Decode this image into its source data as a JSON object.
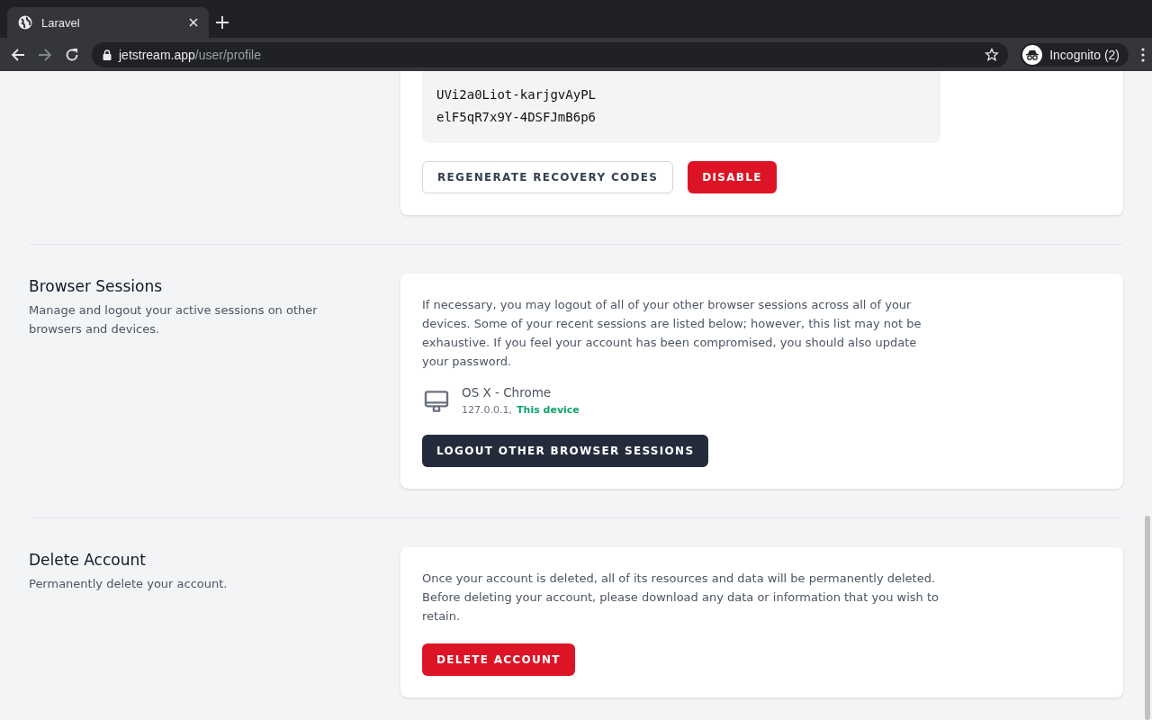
{
  "browser": {
    "tab": {
      "title": "Laravel"
    },
    "url": {
      "host": "jetstream.app",
      "path": "/user/profile"
    },
    "profile": "Incognito (2)"
  },
  "recovery": {
    "codes": [
      "UVi2a0Liot-karjgvAyPL",
      "elF5qR7x9Y-4DSFJmB6p6"
    ],
    "buttons": [
      {
        "label": "REGENERATE RECOVERY CODES",
        "kind": "secondary"
      },
      {
        "label": "DISABLE",
        "kind": "danger"
      }
    ]
  },
  "sections": [
    {
      "title": "Browser Sessions",
      "description": "Manage and logout your active sessions on other browsers and devices.",
      "text": "If necessary, you may logout of all of your other browser sessions across all of your devices. Some of your recent sessions are listed below; however, this list may not be exhaustive. If you feel your account has been compromised, you should also update your password.",
      "sessions": [
        {
          "device": "OS X - Chrome",
          "ip": "127.0.0.1,",
          "note": "This device"
        }
      ],
      "button": {
        "label": "LOGOUT OTHER BROWSER SESSIONS",
        "kind": "dark"
      }
    },
    {
      "title": "Delete Account",
      "description": "Permanently delete your account.",
      "text": "Once your account is deleted, all of its resources and data will be permanently deleted. Before deleting your account, please download any data or information that you wish to retain.",
      "button": {
        "label": "DELETE ACCOUNT",
        "kind": "danger"
      }
    }
  ]
}
